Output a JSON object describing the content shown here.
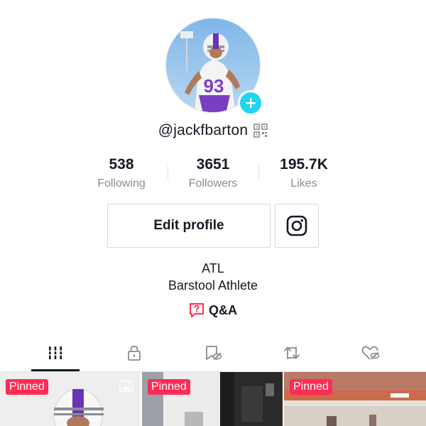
{
  "profile": {
    "username": "@jackfbarton",
    "jersey_number": "93"
  },
  "stats": {
    "following": {
      "value": "538",
      "label": "Following"
    },
    "followers": {
      "value": "3651",
      "label": "Followers"
    },
    "likes": {
      "value": "195.7K",
      "label": "Likes"
    }
  },
  "actions": {
    "edit_profile_label": "Edit profile"
  },
  "bio": {
    "line1": "ATL",
    "line2": "Barstool Athlete"
  },
  "qa": {
    "label": "Q&A"
  },
  "tabs": [
    "videos",
    "private",
    "favorites",
    "reposts",
    "liked"
  ],
  "videos": [
    {
      "badge": "Pinned"
    },
    {
      "badge": "Pinned"
    },
    {
      "badge": "Pinned"
    }
  ],
  "colors": {
    "accent": "#fe2c55",
    "add_button": "#20d5ec",
    "text_primary": "#161823",
    "text_secondary": "#8a8b91"
  }
}
